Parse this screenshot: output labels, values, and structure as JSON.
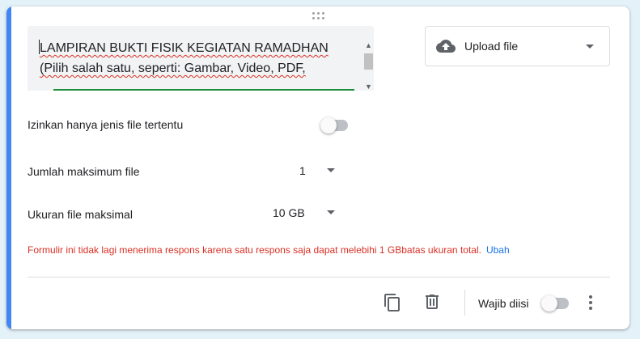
{
  "question": {
    "text": "LAMPIRAN BUKTI FISIK KEGIATAN RAMADHAN (Pilih salah satu, seperti: Gambar, Video, PDF, Dokumen,"
  },
  "type_select": {
    "label": "Upload file",
    "icon": "cloud-upload-icon"
  },
  "settings": {
    "allow_types_label": "Izinkan hanya jenis file tertentu",
    "allow_types_on": false,
    "max_files_label": "Jumlah maksimum file",
    "max_files_value": "1",
    "max_size_label": "Ukuran file maksimal",
    "max_size_value": "10 GB"
  },
  "warning": {
    "text": "Formulir ini tidak lagi menerima respons karena satu respons saja dapat melebihi 1 GBbatas ukuran total.",
    "link": "Ubah"
  },
  "footer": {
    "duplicate_icon": "copy-icon",
    "delete_icon": "trash-icon",
    "required_label": "Wajib diisi",
    "required_on": false,
    "more_icon": "more-vertical-icon"
  },
  "colors": {
    "accent": "#4285f4",
    "warning": "#d93025",
    "link": "#1a73e8",
    "underline_active": "#1e8e3e"
  }
}
